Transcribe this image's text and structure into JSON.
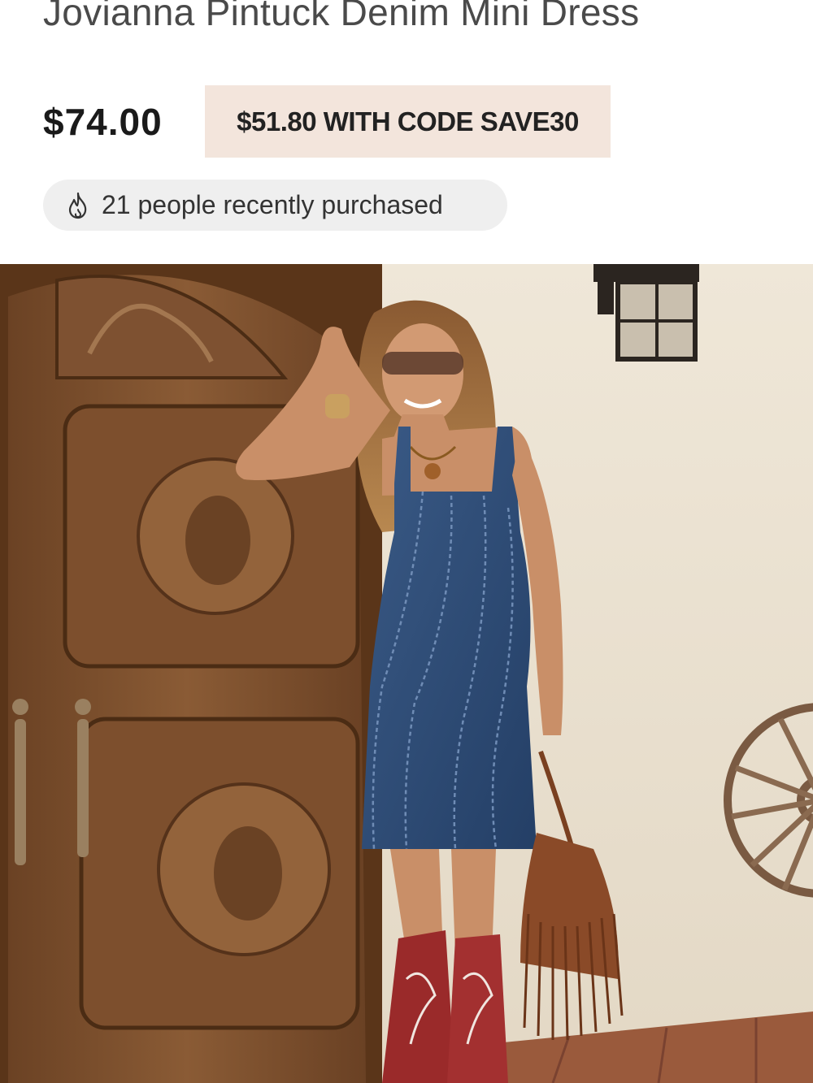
{
  "product": {
    "title": "Jovianna Pintuck Denim Mini Dress",
    "price": "$74.00",
    "promo_text": "$51.80 WITH CODE SAVE30",
    "social_proof": {
      "icon": "flame-icon",
      "text": "21 people recently purchased"
    }
  },
  "image": {
    "subject": "product-photo"
  },
  "colors": {
    "promo_background": "#f3e5dc",
    "pill_background": "#efefef",
    "denim": "#2f4f7a",
    "door_wood": "#7a4f2e",
    "boots": "#9a2a2a",
    "wall": "#eae2d3"
  }
}
